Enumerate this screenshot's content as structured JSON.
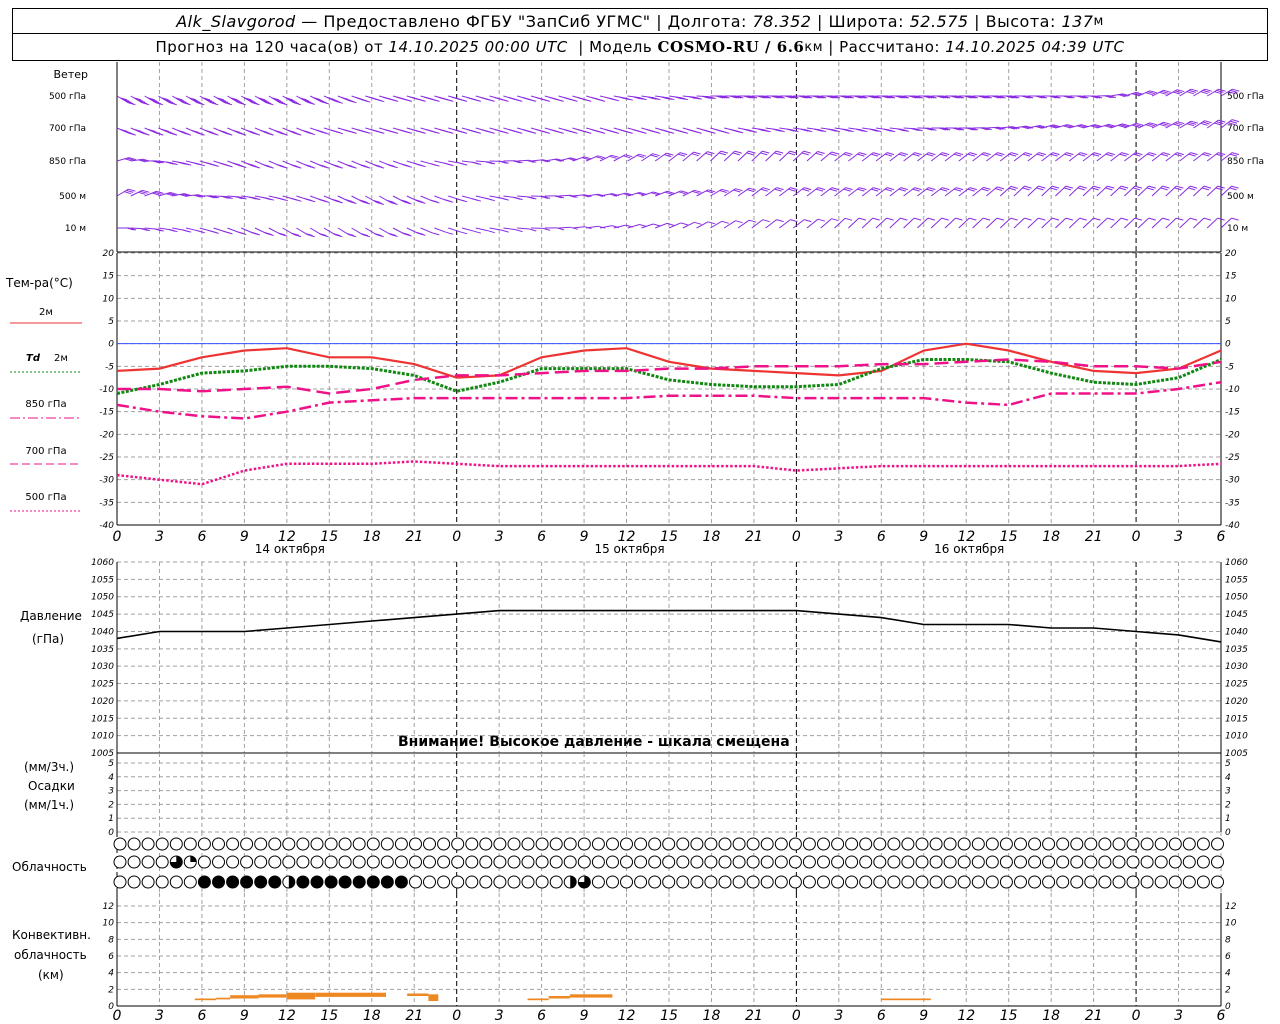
{
  "header": {
    "station": "Alk_Slavgorod",
    "provider": " — Предоставлено ФГБУ \"ЗапСиб УГМС\" | ",
    "lon_label": "Долгота: ",
    "lon": "78.352",
    "lat_label": " | Широта: ",
    "lat": "52.575",
    "alt_label": " | Высота: ",
    "alt": "137",
    "alt_unit": "м",
    "forecast_label": "Прогноз на 120 часа(ов) от ",
    "forecast_from": "14.10.2025 00:00 UTC",
    "model_label": "  | Модель ",
    "model": "COSMO-RU / 6.6",
    "model_unit": "км",
    "calc_label": " | Рассчитано: ",
    "calc_time": "14.10.2025 04:39 UTC"
  },
  "colors": {
    "wind": "#8a2be2",
    "t2m": "#ee3333",
    "td2m": "#118811",
    "t850": "#ee1188",
    "t700": "#ee1188",
    "t500": "#ee1188",
    "pressure": "#000000",
    "conv": "#ee8822",
    "grid": "#a0a0a0"
  },
  "wind_panel": {
    "title": "Ветер",
    "levels": [
      "500 гПа",
      "700 гПа",
      "850 гПа",
      "500 м",
      "10 м"
    ]
  },
  "temp_panel": {
    "title": "Тем-ра(°C)",
    "legend": [
      {
        "label": "2м",
        "key": "t2m",
        "style": "solid"
      },
      {
        "label_a": "Td",
        "label_b": "2м",
        "key": "td2m",
        "style": "dotted"
      },
      {
        "label": "850 гПа",
        "key": "t850",
        "style": "dashdot"
      },
      {
        "label": "700 гПа",
        "key": "t700",
        "style": "dashed"
      },
      {
        "label": "500 гПа",
        "key": "t500",
        "style": "dotted"
      }
    ],
    "yticks": [
      20,
      15,
      10,
      5,
      0,
      -5,
      -10,
      -15,
      -20,
      -25,
      -30,
      -35,
      -40
    ]
  },
  "time_axis": {
    "hours": [
      "0",
      "3",
      "6",
      "9",
      "12",
      "15",
      "18",
      "21",
      "0",
      "3",
      "6",
      "9",
      "12",
      "15",
      "18",
      "21",
      "0",
      "3",
      "6",
      "9",
      "12",
      "15",
      "18",
      "21",
      "0",
      "3",
      "6"
    ],
    "dates": [
      "14 октября",
      "15 октября",
      "16 октября"
    ]
  },
  "pressure_panel": {
    "title": "Давление",
    "unit": "(гПа)",
    "yticks": [
      1060,
      1055,
      1050,
      1045,
      1040,
      1035,
      1030,
      1025,
      1020,
      1015,
      1010,
      1005
    ],
    "warning": "Внимание! Высокое давление - шкала смещена"
  },
  "precip_panel": {
    "unit3": "(мм/3ч.)",
    "title": "Осадки",
    "unit1": "(мм/1ч.)",
    "yticks": [
      5,
      4,
      3,
      2,
      1,
      0
    ]
  },
  "cloud_panel": {
    "title": "Облачность"
  },
  "conv_panel": {
    "title1": "Конвективн.",
    "title2": "облачность",
    "unit": "(км)",
    "yticks": [
      12,
      10,
      8,
      6,
      4,
      2,
      0
    ]
  },
  "chart_data": {
    "type": "line",
    "x_unit": "hours since 14.10.2025 00:00 UTC",
    "x": [
      0,
      3,
      6,
      9,
      12,
      15,
      18,
      21,
      24,
      27,
      30,
      33,
      36,
      39,
      42,
      45,
      48,
      51,
      54,
      57,
      60,
      63,
      66,
      69,
      72,
      75,
      78
    ],
    "series": [
      {
        "name": "2м",
        "key": "t2m",
        "values": [
          -6,
          -5.5,
          -3,
          -1.5,
          -1,
          -3,
          -3,
          -4.5,
          -7.5,
          -7,
          -3,
          -1.5,
          -1,
          -4,
          -5.5,
          -6,
          -6.5,
          -7,
          -6,
          -1.5,
          0,
          -1.5,
          -4,
          -6,
          -6.5,
          -5.5,
          -1.5
        ]
      },
      {
        "name": "Td 2м",
        "key": "td2m",
        "values": [
          -11,
          -9,
          -6.5,
          -6,
          -5,
          -5,
          -5.5,
          -7,
          -10.5,
          -8.5,
          -5.5,
          -5.5,
          -5.5,
          -8,
          -9,
          -9.5,
          -9.5,
          -9,
          -5.5,
          -3.5,
          -3.5,
          -4,
          -6.5,
          -8.5,
          -9,
          -7.5,
          -3.5
        ]
      },
      {
        "name": "850 гПа",
        "key": "t850",
        "values": [
          -13.5,
          -15,
          -16,
          -16.5,
          -15,
          -13,
          -12.5,
          -12,
          -12,
          -12,
          -12,
          -12,
          -12,
          -11.5,
          -11.5,
          -11.5,
          -12,
          -12,
          -12,
          -12,
          -13,
          -13.5,
          -11,
          -11,
          -11,
          -10,
          -8.5
        ]
      },
      {
        "name": "700 гПа",
        "key": "t700",
        "values": [
          -10,
          -10,
          -10.5,
          -10,
          -9.5,
          -11,
          -10,
          -8,
          -7,
          -7,
          -6.5,
          -6,
          -6,
          -5.5,
          -5.5,
          -5,
          -5,
          -5,
          -4.5,
          -4.5,
          -4,
          -3.5,
          -4,
          -5,
          -5,
          -5.5,
          -4
        ]
      },
      {
        "name": "500 гПа",
        "key": "t500",
        "values": [
          -29,
          -30,
          -31,
          -28,
          -26.5,
          -26.5,
          -26.5,
          -26,
          -26.5,
          -27,
          -27,
          -27,
          -27,
          -27,
          -27,
          -27,
          -28,
          -27.5,
          -27,
          -27,
          -27,
          -27,
          -27,
          -27,
          -27,
          -27,
          -26.5
        ]
      },
      {
        "name": "Давление",
        "key": "pressure",
        "values": [
          1038,
          1040,
          1040,
          1040,
          1041,
          1042,
          1043,
          1044,
          1045,
          1046,
          1046,
          1046,
          1046,
          1046,
          1046,
          1046,
          1046,
          1045,
          1044,
          1042,
          1042,
          1042,
          1041,
          1041,
          1040,
          1039,
          1037
        ]
      }
    ],
    "temp_ylim": [
      -40,
      20
    ],
    "pressure_ylim": [
      1005,
      1060
    ],
    "precip_ylim": [
      0,
      5
    ],
    "conv_ylim": [
      0,
      13
    ],
    "cloud_rows": [
      "eeeeeeeeeeeeeeeeeeeeeeeeeeeeeeeeeeeeeeeeeeeeeeeeeeeeeeeeeeeeeeeeeeeeeeeeeeeeeeeeeeee",
      "eeeeqpeeeeeeeeeeeeeeeeeeeeeeeeeeeeeeeeeeeeeeeeeeeeeeeeeeeeeeeeeeeeeeeeeeeeeeeeeeeeeeee",
      "eeeeeeffffffhffffffffeeeeeeeeeeehqeeeeeeeeeeeeeeeeeeeeeeeeeeeeeeeeeeeeeeeeeeeeeeeeeeee"
    ],
    "conv_bars": [
      {
        "x0": 5.5,
        "x1": 7,
        "base": 0.7,
        "top": 0.9
      },
      {
        "x0": 7,
        "x1": 8,
        "base": 0.8,
        "top": 1.0
      },
      {
        "x0": 8,
        "x1": 10,
        "base": 0.9,
        "top": 1.3
      },
      {
        "x0": 10,
        "x1": 12,
        "base": 1.0,
        "top": 1.4
      },
      {
        "x0": 12,
        "x1": 14,
        "base": 0.8,
        "top": 1.6
      },
      {
        "x0": 14,
        "x1": 19,
        "base": 1.1,
        "top": 1.6
      },
      {
        "x0": 20.5,
        "x1": 22,
        "base": 1.2,
        "top": 1.5
      },
      {
        "x0": 22,
        "x1": 22.7,
        "base": 0.6,
        "top": 1.4
      },
      {
        "x0": 29,
        "x1": 30.5,
        "base": 0.7,
        "top": 0.9
      },
      {
        "x0": 30.5,
        "x1": 32,
        "base": 0.9,
        "top": 1.2
      },
      {
        "x0": 32,
        "x1": 35,
        "base": 1.0,
        "top": 1.4
      },
      {
        "x0": 54,
        "x1": 57.5,
        "base": 0.7,
        "top": 0.9
      }
    ],
    "wind_rows": [
      {
        "level": "500 гПа",
        "dir": [
          290,
          290,
          290,
          290,
          290,
          285,
          280,
          280,
          280,
          280,
          280,
          280,
          275,
          275,
          270,
          270,
          270,
          270,
          270,
          270,
          270,
          270,
          270,
          270,
          255,
          250,
          250
        ],
        "speed": [
          55,
          50,
          45,
          45,
          45,
          45,
          45,
          45,
          45,
          40,
          40,
          40,
          40,
          35,
          35,
          35,
          35,
          35,
          35,
          35,
          35,
          35,
          30,
          30,
          30,
          30,
          25
        ]
      },
      {
        "level": "700 гПа",
        "dir": [
          285,
          285,
          285,
          285,
          285,
          280,
          280,
          280,
          280,
          280,
          280,
          280,
          280,
          280,
          280,
          275,
          275,
          275,
          275,
          270,
          270,
          265,
          260,
          260,
          255,
          250,
          245
        ],
        "speed": [
          45,
          45,
          40,
          40,
          40,
          40,
          40,
          40,
          35,
          35,
          35,
          35,
          35,
          35,
          35,
          35,
          30,
          30,
          30,
          30,
          30,
          30,
          30,
          30,
          30,
          25,
          25
        ]
      },
      {
        "level": "850 гПа",
        "dir": [
          260,
          275,
          280,
          285,
          285,
          285,
          285,
          280,
          275,
          270,
          265,
          255,
          250,
          245,
          240,
          240,
          240,
          245,
          245,
          245,
          245,
          245,
          245,
          245,
          245,
          245,
          245
        ],
        "speed": [
          30,
          35,
          35,
          35,
          30,
          30,
          30,
          25,
          20,
          20,
          20,
          15,
          15,
          15,
          15,
          15,
          15,
          20,
          20,
          20,
          20,
          20,
          20,
          20,
          20,
          20,
          20
        ]
      },
      {
        "level": "500 м",
        "dir": [
          250,
          260,
          270,
          275,
          280,
          285,
          290,
          285,
          280,
          275,
          270,
          265,
          260,
          255,
          250,
          245,
          245,
          245,
          245,
          245,
          245,
          240,
          240,
          240,
          240,
          240,
          240
        ],
        "speed": [
          30,
          30,
          30,
          30,
          30,
          25,
          25,
          25,
          20,
          20,
          20,
          15,
          15,
          15,
          15,
          15,
          15,
          15,
          15,
          15,
          15,
          15,
          15,
          15,
          15,
          15,
          15
        ]
      },
      {
        "level": "10 м",
        "dir": [
          270,
          275,
          280,
          285,
          290,
          290,
          290,
          285,
          280,
          275,
          270,
          265,
          260,
          255,
          250,
          245,
          245,
          240,
          240,
          240,
          240,
          240,
          240,
          240,
          240,
          240,
          240
        ],
        "speed": [
          15,
          15,
          15,
          15,
          15,
          15,
          15,
          15,
          10,
          10,
          10,
          10,
          10,
          10,
          10,
          10,
          10,
          10,
          10,
          10,
          10,
          10,
          10,
          10,
          10,
          10,
          10
        ]
      }
    ]
  }
}
